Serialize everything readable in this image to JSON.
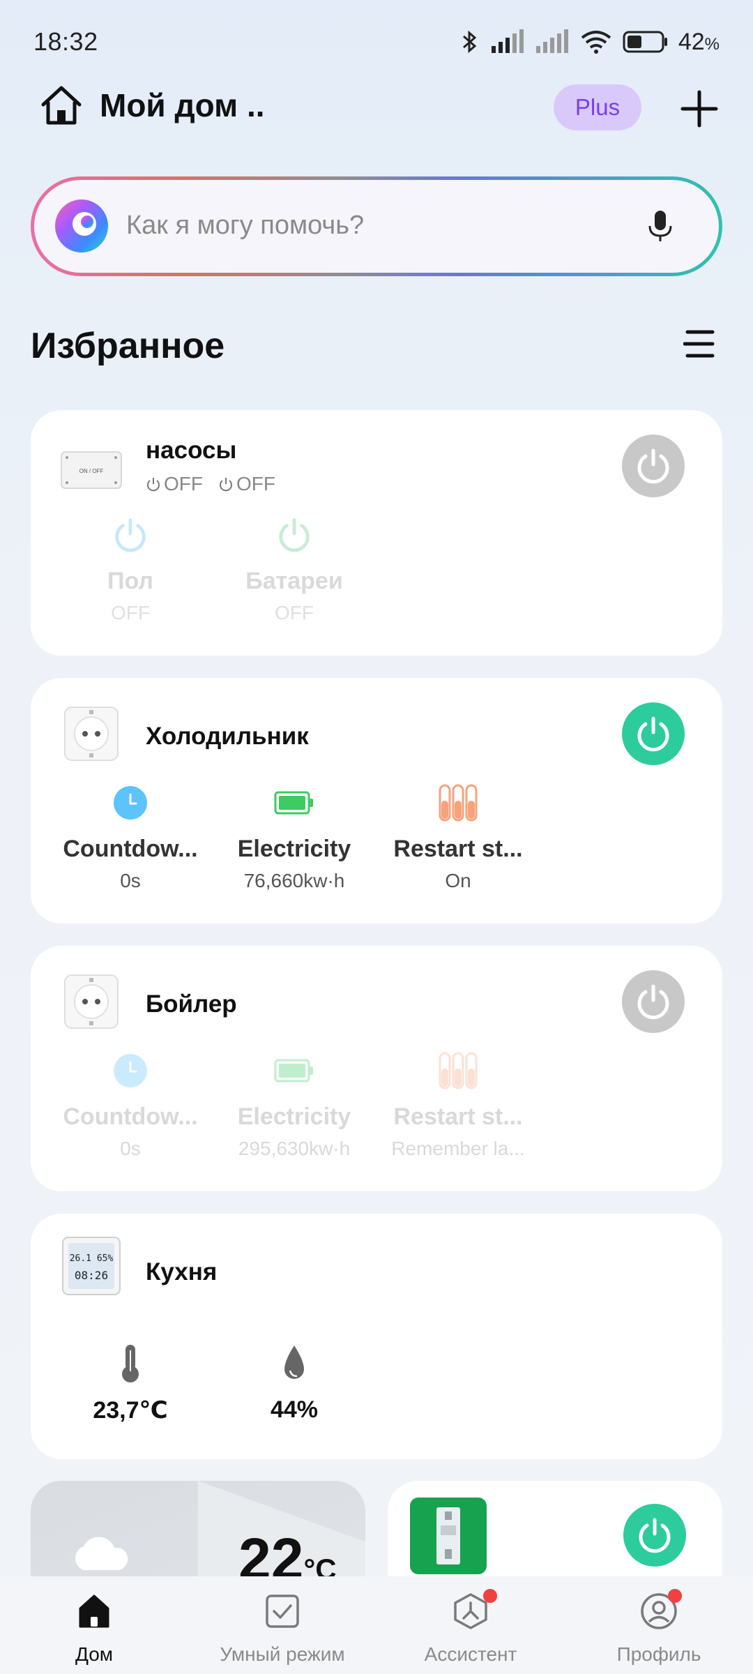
{
  "status_bar": {
    "time": "18:32",
    "battery_percent": "42",
    "battery_unit": "%"
  },
  "header": {
    "home_title": "Мой дом ..",
    "plus_label": "Plus"
  },
  "search": {
    "placeholder": "Как я могу помочь?"
  },
  "favorites": {
    "title": "Избранное"
  },
  "cards": [
    {
      "title": "насосы",
      "icon": "switch-module-icon",
      "power_state": "off",
      "status": [
        "OFF",
        "OFF"
      ],
      "attributes": [
        {
          "name": "Пол",
          "value": "OFF",
          "icon": "power-icon"
        },
        {
          "name": "Батареи",
          "value": "OFF",
          "icon": "power-icon"
        }
      ]
    },
    {
      "title": "Холодильник",
      "icon": "socket-icon",
      "power_state": "on",
      "attributes": [
        {
          "name": "Countdow...",
          "value": "0s",
          "icon": "clock-icon"
        },
        {
          "name": "Electricity",
          "value": "76,660kw·h",
          "icon": "battery-icon"
        },
        {
          "name": "Restart st...",
          "value": "On",
          "icon": "restart-status-icon"
        }
      ]
    },
    {
      "title": "Бойлер",
      "icon": "socket-icon",
      "power_state": "off",
      "attributes": [
        {
          "name": "Countdow...",
          "value": "0s",
          "icon": "clock-icon"
        },
        {
          "name": "Electricity",
          "value": "295,630kw·h",
          "icon": "battery-icon"
        },
        {
          "name": "Restart st...",
          "value": "Remember la...",
          "icon": "restart-status-icon"
        }
      ]
    },
    {
      "title": "Кухня",
      "icon": "thermometer-display-icon",
      "display": {
        "line1": "26.1 65%",
        "line2": "08:26"
      },
      "attributes": [
        {
          "name": "23,7℃",
          "icon": "thermometer-icon"
        },
        {
          "name": "44%",
          "icon": "humidity-icon"
        }
      ]
    }
  ],
  "weather": {
    "temp": "22",
    "unit": "°C",
    "icon": "cloud-icon"
  },
  "bottom_device": {
    "icon": "breaker-icon",
    "power_state": "on"
  },
  "nav": [
    {
      "label": "Дом",
      "icon": "home-icon",
      "active": true
    },
    {
      "label": "Умный режим",
      "icon": "checkbox-icon",
      "active": false
    },
    {
      "label": "Ассистент",
      "icon": "assistant-icon",
      "active": false,
      "badge": true
    },
    {
      "label": "Профиль",
      "icon": "profile-icon",
      "active": false,
      "badge": true
    }
  ],
  "colors": {
    "power_on": "#2ccc9c",
    "power_off": "#c8c8c8",
    "plus_bg": "#d9c9fb",
    "plus_text": "#7a3ff0",
    "badge_red": "#f04040"
  }
}
